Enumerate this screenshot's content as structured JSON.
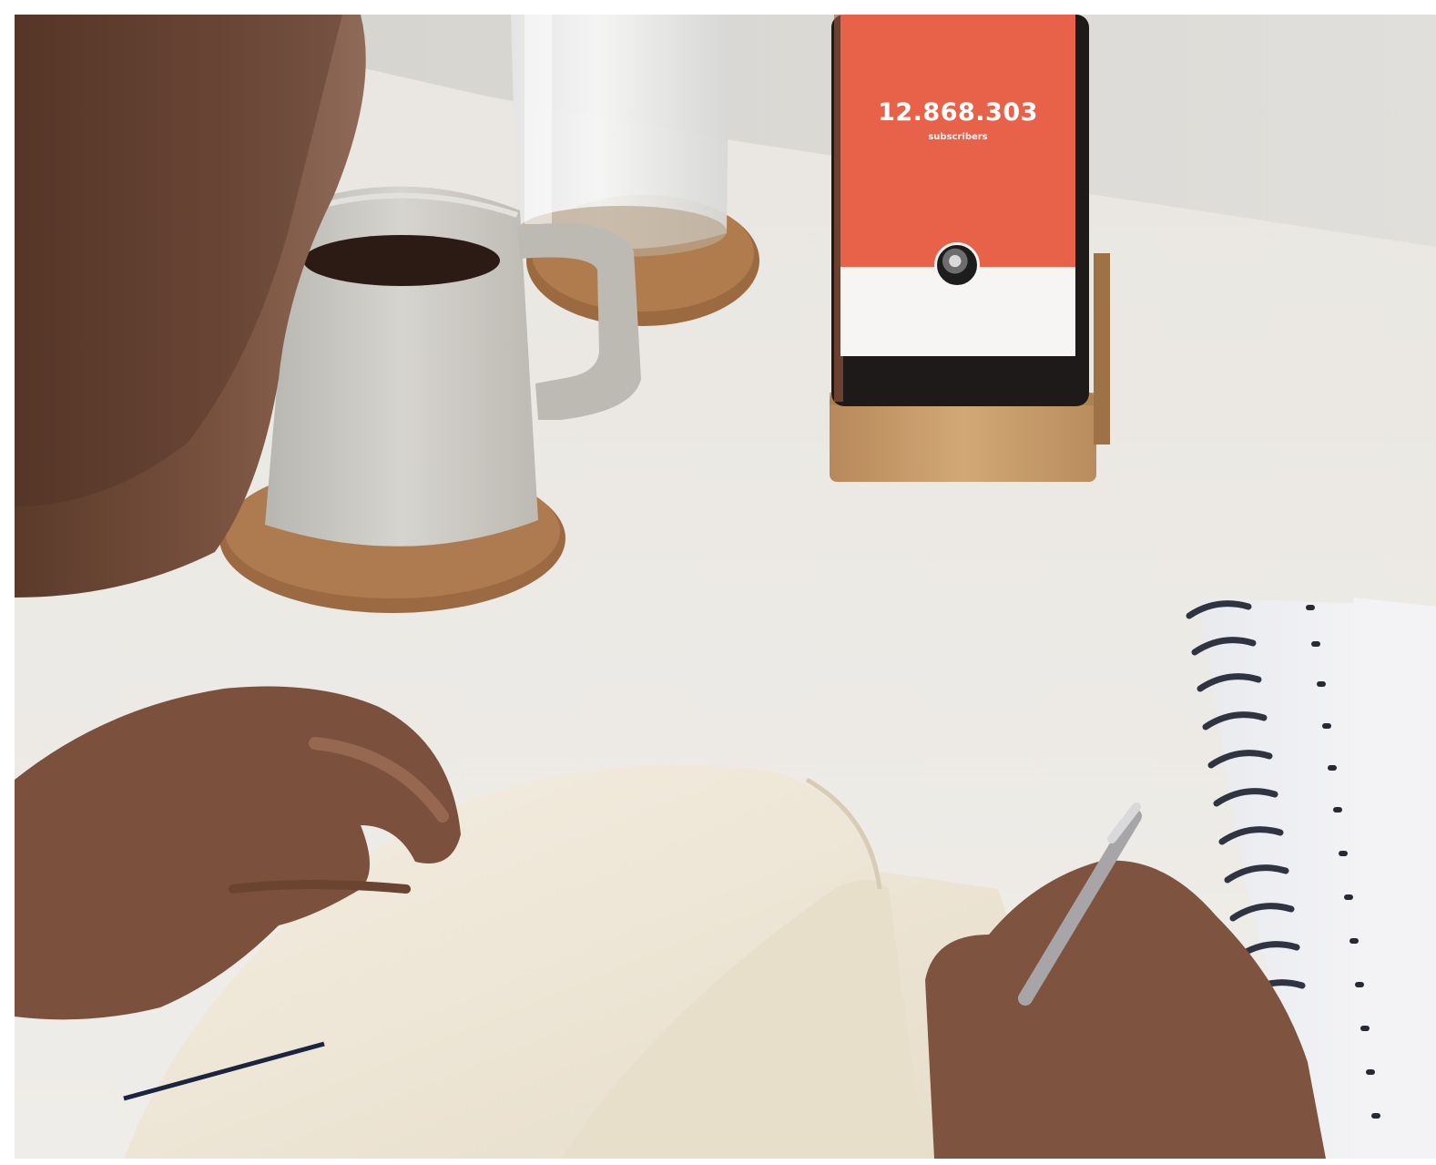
{
  "photo": {
    "phone": {
      "subscriber_count": "12.868.303",
      "subscriber_label": "subscribers",
      "screen_top_color": "#e8624a",
      "screen_bottom_color": "#f7f5f3"
    }
  },
  "colors": {
    "table": "#ebe8e3",
    "wall": "#dcdad6",
    "cork": "#a8774c",
    "mug": "#c9c6bf",
    "bamboo": "#c79b66",
    "notebook": "#f1eadb",
    "skin": "#8a5c44"
  }
}
